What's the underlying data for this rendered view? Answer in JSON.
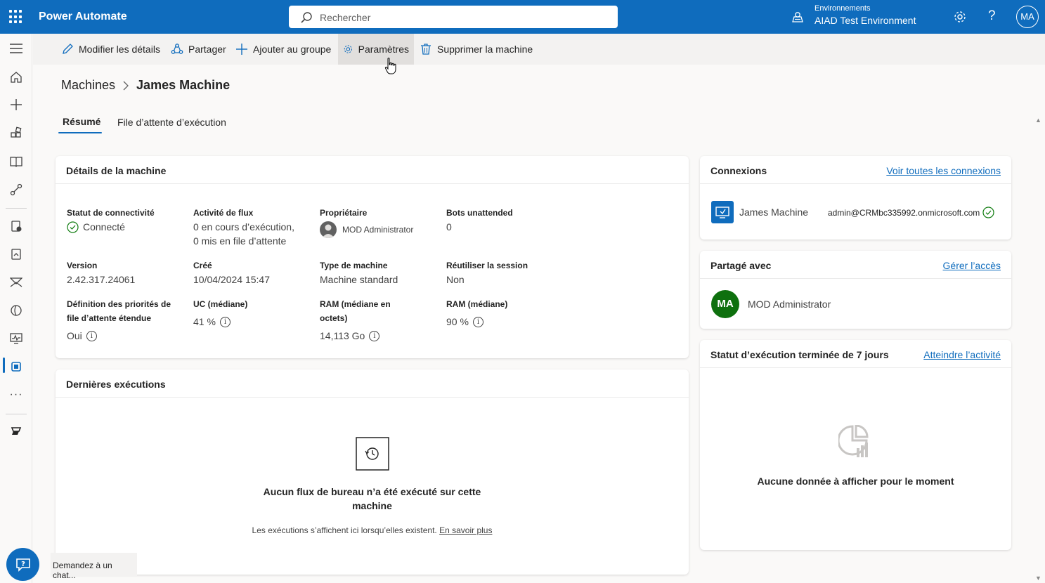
{
  "app": {
    "title": "Power Automate"
  },
  "search": {
    "placeholder": "Rechercher"
  },
  "environment": {
    "label": "Environnements",
    "name": "AIAD Test Environment"
  },
  "user": {
    "initials": "MA"
  },
  "commands": [
    {
      "label": "Modifier les détails",
      "icon": "pencil-icon"
    },
    {
      "label": "Partager",
      "icon": "share-icon"
    },
    {
      "label": "Ajouter au groupe",
      "icon": "plus-icon"
    },
    {
      "label": "Paramètres",
      "icon": "gear-icon"
    },
    {
      "label": "Supprimer la machine",
      "icon": "trash-icon"
    }
  ],
  "breadcrumb": {
    "parent": "Machines",
    "current": "James Machine"
  },
  "tabs": [
    {
      "label": "Résumé",
      "active": true
    },
    {
      "label": "File d’attente d’exécution",
      "active": false
    }
  ],
  "details": {
    "title": "Détails de la machine",
    "connectivity_label": "Statut de connectivité",
    "connectivity_value": "Connecté",
    "flow_activity_label": "Activité de flux",
    "flow_activity_line1": "0 en cours d’exécution,",
    "flow_activity_line2": "0 mis en file d’attente",
    "owner_label": "Propriétaire",
    "owner_value": "MOD Administrator",
    "bots_label": "Bots unattended",
    "bots_value": "0",
    "version_label": "Version",
    "version_value": "2.42.317.24061",
    "created_label": "Créé",
    "created_value": "10/04/2024 15:47",
    "type_label": "Type de machine",
    "type_value": "Machine standard",
    "reuse_label": "Réutiliser la session",
    "reuse_value": "Non",
    "priority_label_line1": "Définition des priorités de",
    "priority_label_line2": "file d’attente étendue",
    "priority_value": "Oui",
    "cpu_label": "UC (médiane)",
    "cpu_value": "41 %",
    "ram_oct_label_line1": "RAM (médiane en",
    "ram_oct_label_line2": "octets)",
    "ram_oct_value": "14,113 Go",
    "ram_label": "RAM (médiane)",
    "ram_value": "90 %"
  },
  "runs": {
    "title": "Dernières exécutions",
    "empty_title_line1": "Aucun flux de bureau n’a été exécuté sur cette",
    "empty_title_line2": "machine",
    "empty_sub": "Les exécutions s’affichent ici lorsqu’elles existent.",
    "empty_link": "En savoir plus"
  },
  "connections": {
    "title": "Connexions",
    "link": "Voir toutes les connexions",
    "machine": "James Machine",
    "account": "admin@CRMbc335992.onmicrosoft.com"
  },
  "shared": {
    "title": "Partagé avec",
    "link": "Gérer l’accès",
    "initials": "MA",
    "name": "MOD Administrator"
  },
  "status7": {
    "title": "Statut d’exécution terminée de 7 jours",
    "link": "Atteindre l’activité",
    "empty": "Aucune donnée à afficher pour le moment"
  },
  "chat": {
    "tooltip": "Demandez à un chat..."
  },
  "colors": {
    "brand": "#0f6cbd",
    "success": "#107c10",
    "avatar_green": "#0e700e"
  }
}
